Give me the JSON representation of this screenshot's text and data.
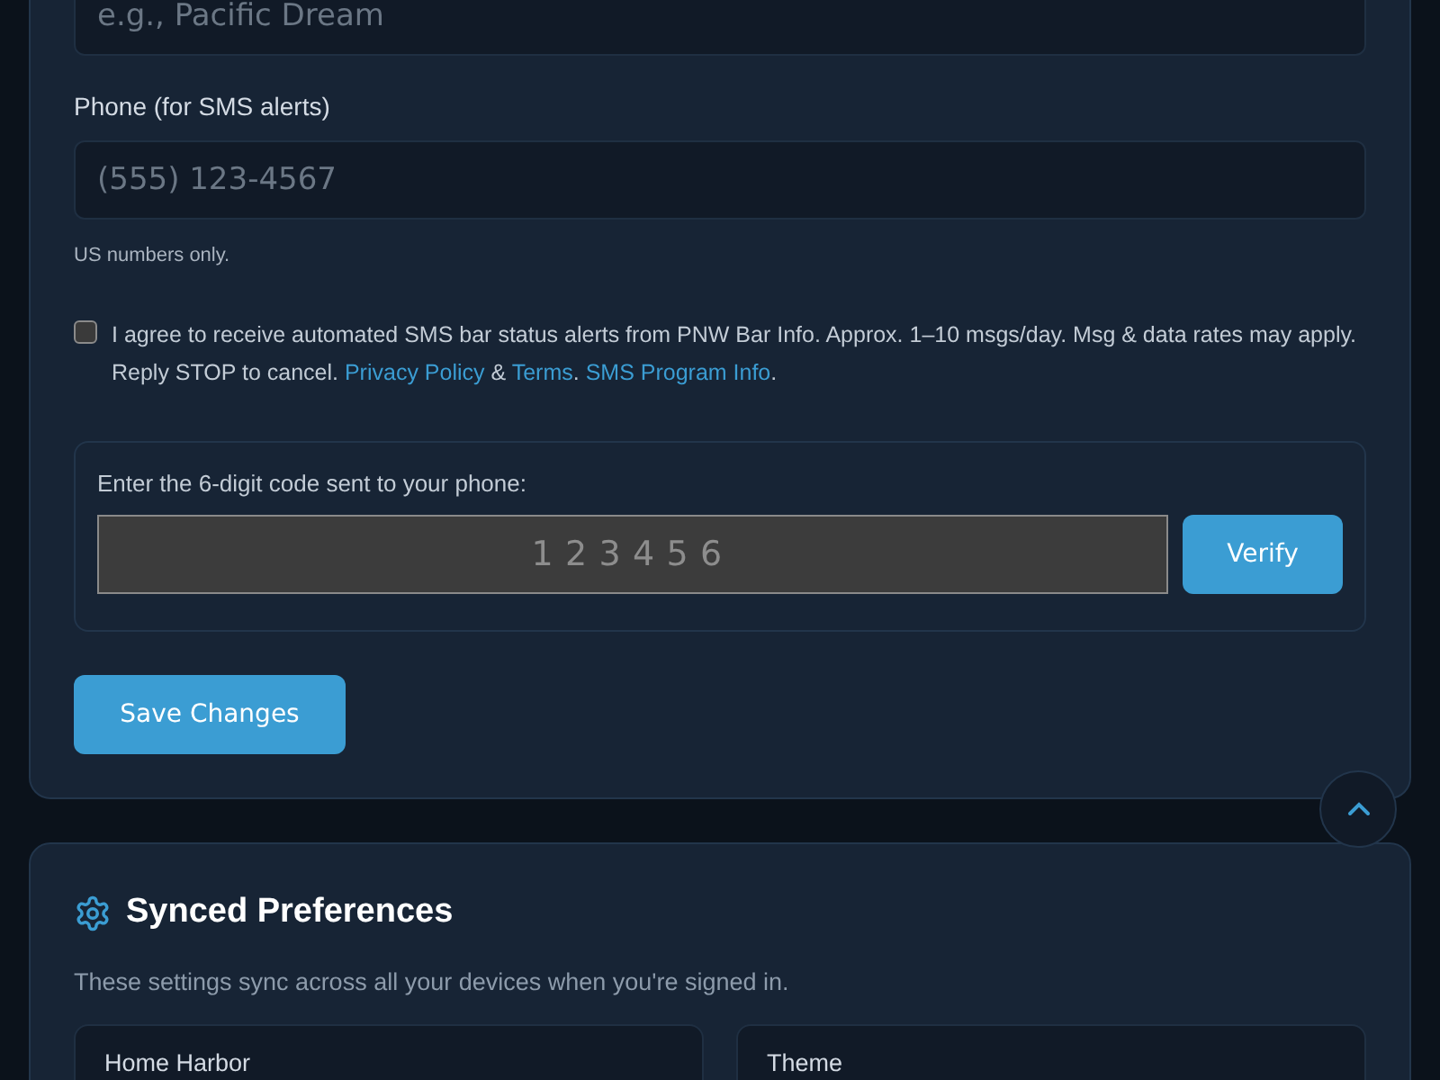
{
  "name_field": {
    "placeholder": "e.g., Pacific Dream"
  },
  "phone": {
    "label": "Phone (for SMS alerts)",
    "placeholder": "(555) 123-4567",
    "hint": "US numbers only."
  },
  "consent": {
    "checked": false,
    "parts": [
      {
        "kind": "text",
        "text": "I agree to receive automated SMS bar status alerts from PNW Bar Info. Approx. 1–10 msgs/day. Msg & data rates may apply. Reply STOP to cancel. "
      },
      {
        "kind": "link",
        "text": "Privacy Policy"
      },
      {
        "kind": "text",
        "text": " & "
      },
      {
        "kind": "link",
        "text": "Terms"
      },
      {
        "kind": "text",
        "text": ". "
      },
      {
        "kind": "link",
        "text": "SMS Program Info"
      },
      {
        "kind": "text",
        "text": "."
      }
    ]
  },
  "verification": {
    "label": "Enter the 6-digit code sent to your phone:",
    "placeholder": "123456",
    "button": "Verify"
  },
  "save_button": "Save Changes",
  "synced": {
    "title": "Synced Preferences",
    "description": "These settings sync across all your devices when you're signed in.",
    "cards": [
      {
        "label": "Home Harbor"
      },
      {
        "label": "Theme"
      }
    ]
  }
}
